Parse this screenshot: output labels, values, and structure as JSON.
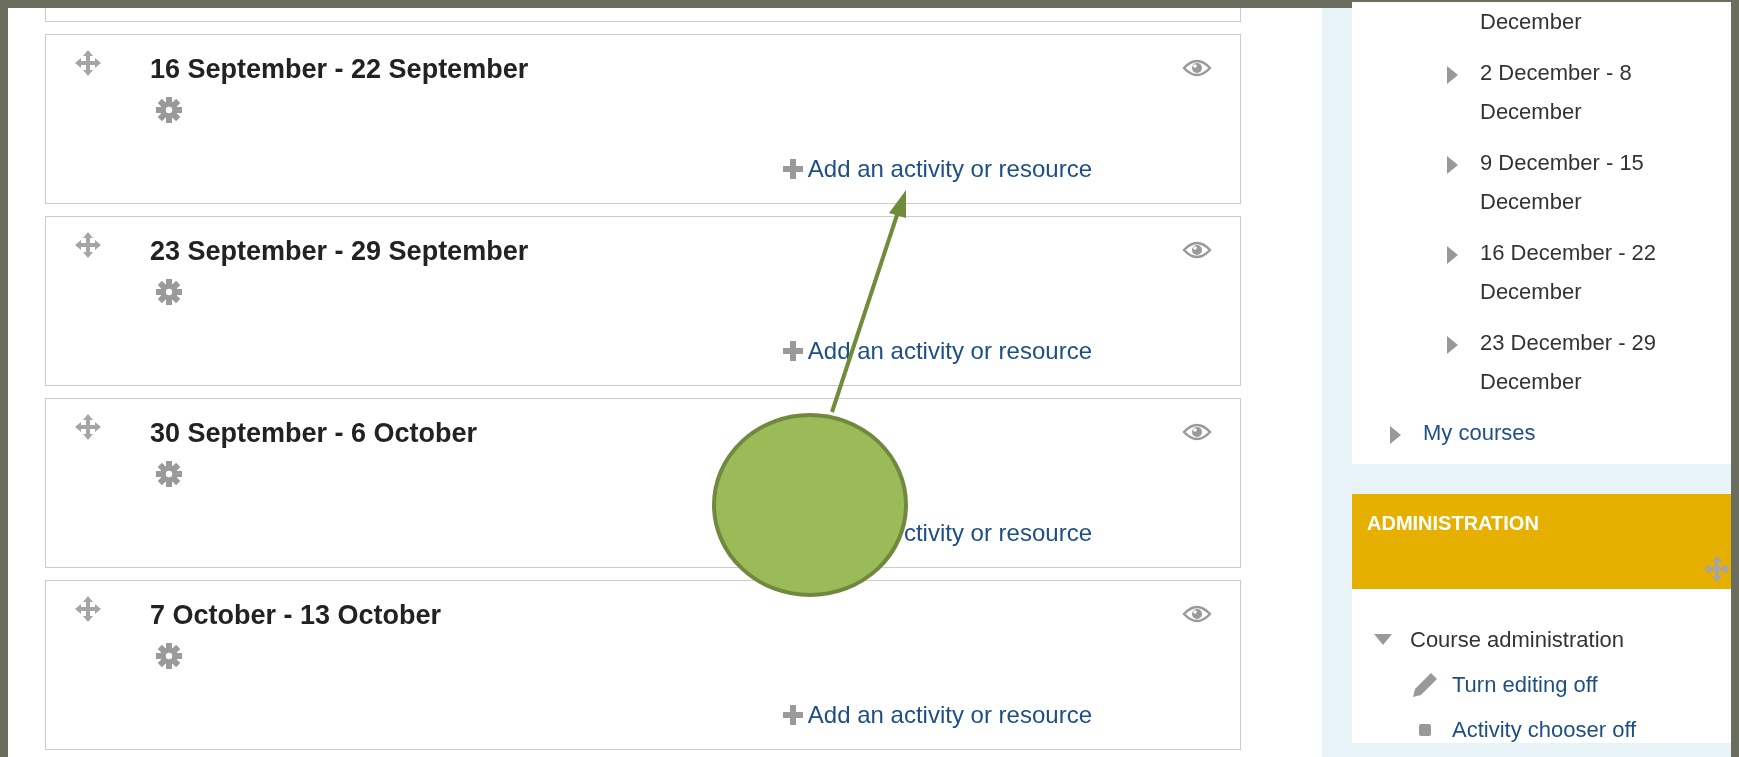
{
  "sections": [
    {
      "title": "16 September - 22 September",
      "add_link": "Add an activity or resource",
      "plus_shown": true
    },
    {
      "title": "23 September - 29 September",
      "add_link": "Add an activity or resource",
      "plus_shown": true
    },
    {
      "title": "30 September - 6 October",
      "add_link": "ctivity or resource",
      "plus_shown": false
    },
    {
      "title": "7 October - 13 October",
      "add_link": "Add an activity or resource",
      "plus_shown": true
    }
  ],
  "navigation": [
    {
      "kind": "folder",
      "children": [
        {
          "kind": "fragment",
          "label": "December"
        },
        {
          "kind": "week",
          "label": "2 December - 8 December",
          "expanded": false
        },
        {
          "kind": "week",
          "label": "9 December - 15 December",
          "expanded": false
        },
        {
          "kind": "week",
          "label": "16 December - 22 December",
          "expanded": false
        },
        {
          "kind": "week",
          "label": "23 December - 29 December",
          "expanded": false
        }
      ]
    },
    {
      "kind": "link",
      "label": "My courses",
      "expanded": false
    }
  ],
  "administration": {
    "title": "ADMINISTRATION",
    "items": [
      {
        "label": "Course administration",
        "expanded": true,
        "children": [
          {
            "kind": "edit",
            "label": "Turn editing off"
          },
          {
            "kind": "setting",
            "label": "Activity chooser off"
          }
        ]
      }
    ]
  }
}
